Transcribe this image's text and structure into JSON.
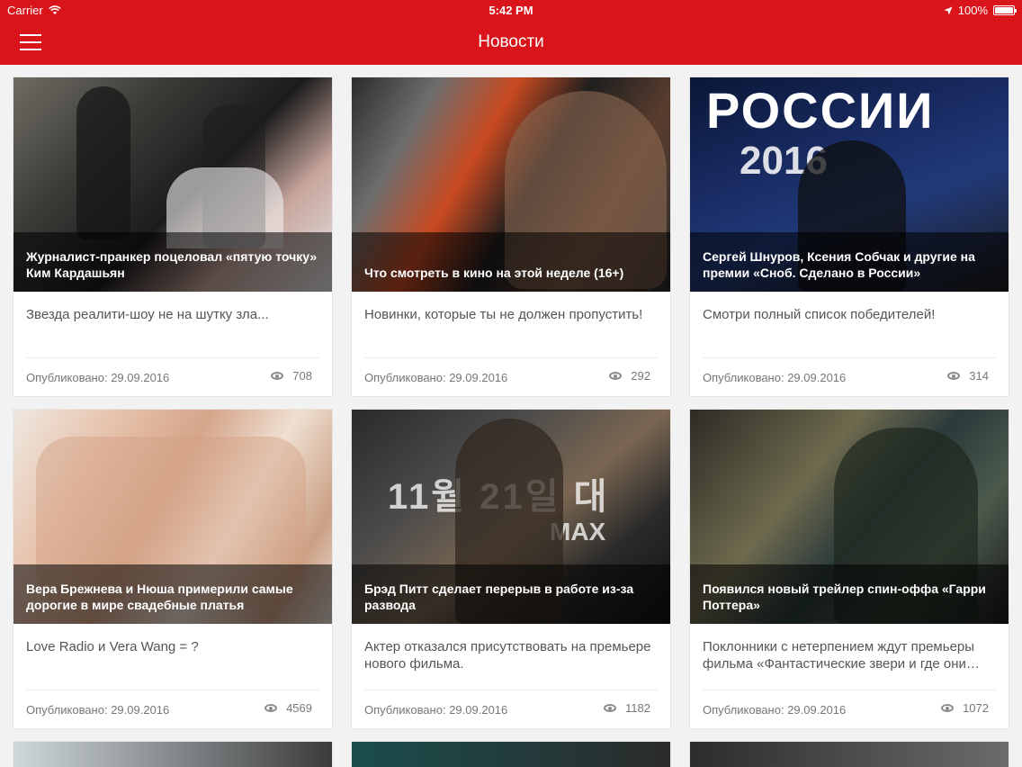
{
  "status_bar": {
    "carrier": "Carrier",
    "time": "5:42 PM",
    "battery": "100%",
    "wifi_icon": "wifi-icon",
    "location_icon": "location-arrow-icon"
  },
  "nav": {
    "title": "Новости",
    "menu_icon": "hamburger-menu-icon",
    "accent_color": "#d9141b"
  },
  "cards": [
    {
      "headline": "Журналист-пранкер поцеловал «пятую точку» Ким Кардашьян",
      "description": "Звезда реалити-шоу не на шутку зла...",
      "date": "Опубликовано: 29.09.2016",
      "views": "708"
    },
    {
      "headline": "Что смотреть в кино на этой неделе (16+)",
      "description": "Новинки, которые ты не должен пропустить!",
      "date": "Опубликовано: 29.09.2016",
      "views": "292"
    },
    {
      "headline": "Сергей Шнуров,  Ксения Собчак и другие на премии «Сноб. Сделано в России»",
      "description": "Смотри полный список победителей!",
      "date": "Опубликовано: 29.09.2016",
      "views": "314",
      "image_text": [
        "РОССИИ",
        "2016"
      ]
    },
    {
      "headline": "Вера Брежнева и Нюша примерили самые дорогие в мире свадебные платья",
      "description": "Love Radio и Vera Wang = ?",
      "date": "Опубликовано: 29.09.2016",
      "views": "4569"
    },
    {
      "headline": "Брэд Питт сделает перерыв в работе из-за развода",
      "description": "Актер отказался присутствовать на премьере нового фильма.",
      "date": "Опубликовано: 29.09.2016",
      "views": "1182",
      "image_text": [
        "11월 21일 대",
        "MAX"
      ]
    },
    {
      "headline": "Появился новый трейлер спин-оффа «Гарри Поттера»",
      "description": "Поклонники с нетерпением ждут премьеры фильма «Фантастические звери и где они…",
      "date": "Опубликовано: 29.09.2016",
      "views": "1072"
    }
  ]
}
